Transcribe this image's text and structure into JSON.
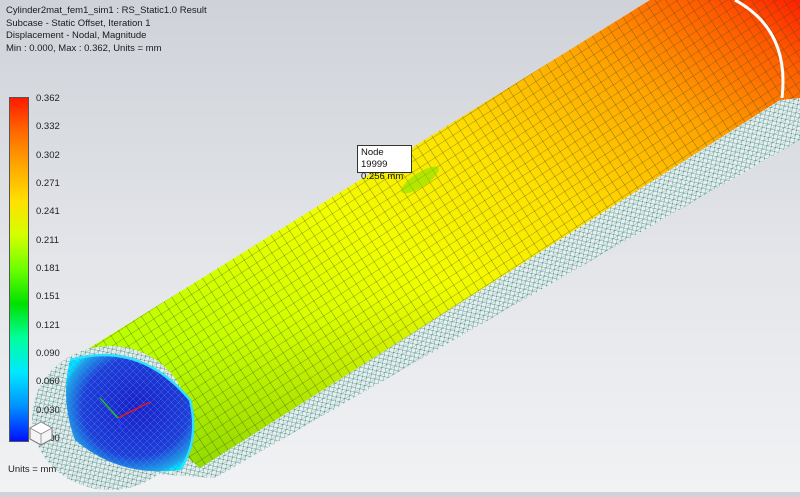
{
  "result_header": {
    "line1": "Cylinder2mat_fem1_sim1 : RS_Static1.0 Result",
    "line2": "Subcase - Static Offset, Iteration 1",
    "line3": "Displacement - Nodal, Magnitude",
    "line4": "Min : 0.000, Max : 0.362, Units = mm"
  },
  "legend": {
    "labels": [
      "0.362",
      "0.332",
      "0.302",
      "0.271",
      "0.241",
      "0.211",
      "0.181",
      "0.151",
      "0.121",
      "0.090",
      "0.060",
      "0.030",
      "0.000"
    ],
    "units": "Units = mm"
  },
  "probe": {
    "node": "Node 19999",
    "value": "0.256 mm"
  },
  "colors": {
    "max": "#ff1a00",
    "mid": "#d4ff00",
    "min": "#0010ff",
    "mesh_line": "#4a5a20",
    "outer_mesh": "#2f7a6a"
  },
  "icons": {
    "view_triad": "view-triad-icon"
  }
}
